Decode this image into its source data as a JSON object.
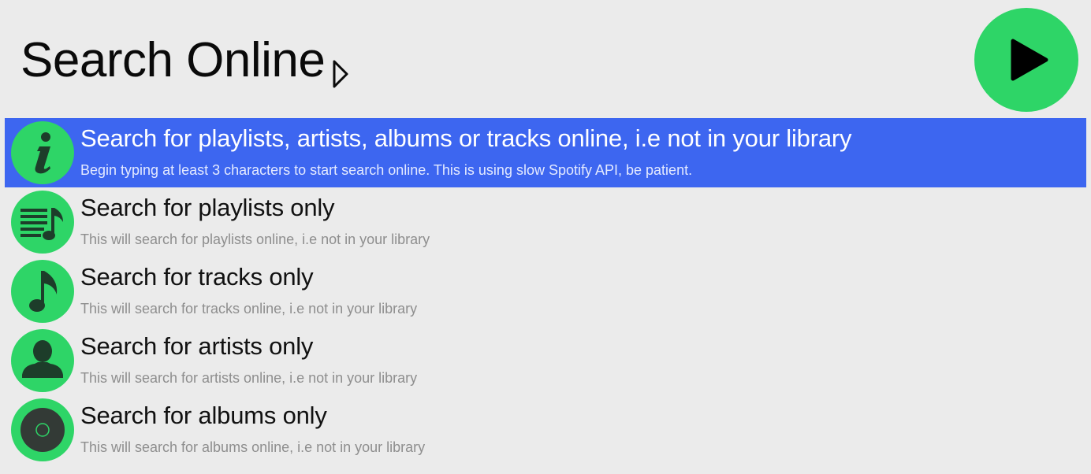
{
  "header": {
    "title": "Search Online",
    "caret_icon": "triangle-right-outline-icon",
    "play_icon": "play-icon"
  },
  "colors": {
    "accent_green": "#2ed567",
    "selection_blue": "#3d66f0",
    "background": "#ebebeb"
  },
  "list": {
    "items": [
      {
        "icon": "info-icon",
        "title": "Search for playlists, artists, albums or tracks online, i.e not in your library",
        "subtitle": "Begin typing at least 3 characters to start search online. This is using slow Spotify API, be patient.",
        "selected": true
      },
      {
        "icon": "playlist-icon",
        "title": "Search for playlists only",
        "subtitle": "This will search for playlists online, i.e not in your library",
        "selected": false
      },
      {
        "icon": "music-note-icon",
        "title": "Search for tracks only",
        "subtitle": "This will search for tracks online, i.e not in your library",
        "selected": false
      },
      {
        "icon": "artist-icon",
        "title": "Search for artists only",
        "subtitle": "This will search for artists online, i.e not in your library",
        "selected": false
      },
      {
        "icon": "album-icon",
        "title": "Search for albums only",
        "subtitle": "This will search for albums online, i.e not in your library",
        "selected": false
      }
    ]
  }
}
